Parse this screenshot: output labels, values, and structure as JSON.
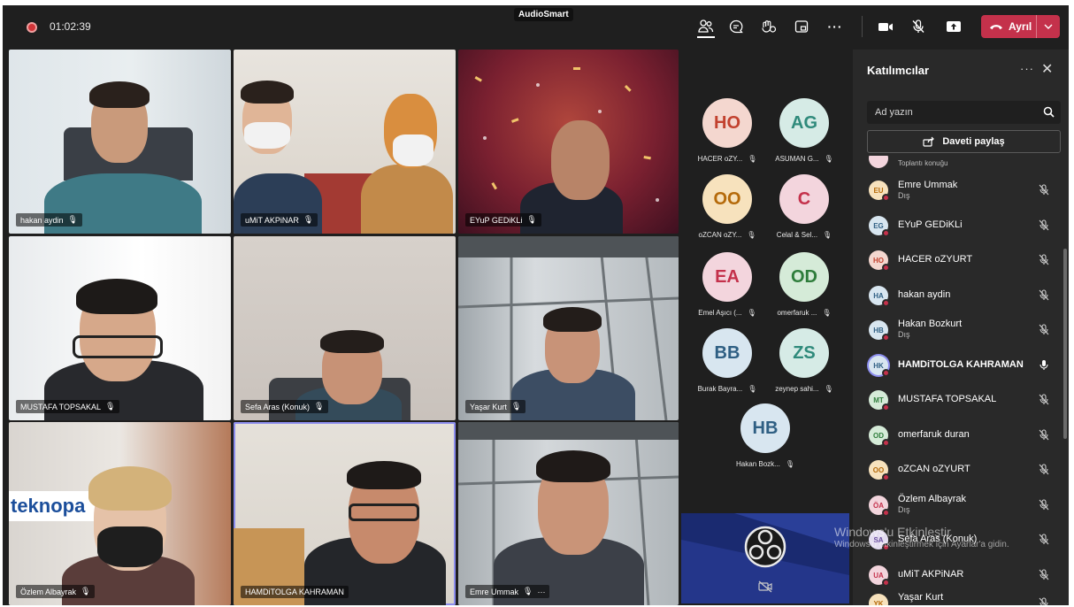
{
  "window": {
    "app_title": "AudioSmart"
  },
  "meeting": {
    "timer": "01:02:39"
  },
  "toolbar": {
    "buttons": [
      "people-icon",
      "chat-icon",
      "reactions-icon",
      "rooms-icon",
      "more-icon",
      "camera-icon",
      "mic-muted-icon",
      "share-icon"
    ],
    "leave_label": "Ayrıl"
  },
  "video_tiles": [
    {
      "name": "hakan aydin"
    },
    {
      "name": "uMiT AKPiNAR"
    },
    {
      "name": "EYuP GEDiKLi"
    },
    {
      "name": "MUSTAFA TOPSAKAL"
    },
    {
      "name": "Sefa Aras (Konuk)"
    },
    {
      "name": "Yaşar Kurt"
    },
    {
      "name": "Özlem Albayrak"
    },
    {
      "name": "HAMDiTOLGA KAHRAMAN"
    },
    {
      "name": "Emre Ummak",
      "more": "···"
    }
  ],
  "sign_text": "teknopa",
  "avatar_tiles": [
    {
      "initials": "HO",
      "label": "HACER oZY...",
      "bg": "#f4d7cf",
      "fg": "#c2412e"
    },
    {
      "initials": "AG",
      "label": "ASUMAN G...",
      "bg": "#d6ebe6",
      "fg": "#2f8a7b"
    },
    {
      "initials": "OO",
      "label": "oZCAN oZY...",
      "bg": "#f7e2bd",
      "fg": "#b56a0a"
    },
    {
      "initials": "C",
      "label": "Celal & Sel...",
      "bg": "#f3d5dd",
      "fg": "#c4314b"
    },
    {
      "initials": "EA",
      "label": "Emel Aşıcı (...",
      "bg": "#f3d5dd",
      "fg": "#c4314b"
    },
    {
      "initials": "OD",
      "label": "omerfaruk ...",
      "bg": "#d5ebd8",
      "fg": "#2e7d3b"
    },
    {
      "initials": "BB",
      "label": "Burak Bayra...",
      "bg": "#d8e6f0",
      "fg": "#2f5f83"
    },
    {
      "initials": "ZS",
      "label": "zeynep sahi...",
      "bg": "#d6ebe6",
      "fg": "#2f8a7b"
    },
    {
      "initials": "HB",
      "label": "Hakan Bozk...",
      "bg": "#d8e6f0",
      "fg": "#2f5f83"
    }
  ],
  "panel": {
    "title": "Katılımcılar",
    "more": "···",
    "close": "✕",
    "search_placeholder": "Ad yazın",
    "share_label": "Daveti paylaş",
    "partial_label": "Toplantı konuğu",
    "participants": [
      {
        "initials": "EU",
        "name": "Emre Ummak",
        "sub": "Dış",
        "bg": "#f7e2bd",
        "fg": "#b56a0a",
        "mic": "muted"
      },
      {
        "initials": "EG",
        "name": "EYuP GEDiKLi",
        "sub": "",
        "bg": "#d8e6f0",
        "fg": "#2f5f83",
        "mic": "muted"
      },
      {
        "initials": "HO",
        "name": "HACER oZYURT",
        "sub": "",
        "bg": "#f4d7cf",
        "fg": "#c2412e",
        "mic": "muted"
      },
      {
        "initials": "HA",
        "name": "hakan aydin",
        "sub": "",
        "bg": "#d8e6f0",
        "fg": "#2f5f83",
        "mic": "muted"
      },
      {
        "initials": "HB",
        "name": "Hakan Bozkurt",
        "sub": "Dış",
        "bg": "#d8e6f0",
        "fg": "#2f5f83",
        "mic": "muted"
      },
      {
        "initials": "HK",
        "name": "HAMDiTOLGA KAHRAMAN",
        "sub": "",
        "bg": "#d8e6f0",
        "fg": "#2f5f83",
        "mic": "on"
      },
      {
        "initials": "MT",
        "name": "MUSTAFA TOPSAKAL",
        "sub": "",
        "bg": "#d5ebd8",
        "fg": "#2e7d3b",
        "mic": "muted"
      },
      {
        "initials": "OD",
        "name": "omerfaruk duran",
        "sub": "",
        "bg": "#d5ebd8",
        "fg": "#2e7d3b",
        "mic": "muted"
      },
      {
        "initials": "OO",
        "name": "oZCAN oZYURT",
        "sub": "",
        "bg": "#f7e2bd",
        "fg": "#b56a0a",
        "mic": "muted"
      },
      {
        "initials": "ÖA",
        "name": "Özlem Albayrak",
        "sub": "Dış",
        "bg": "#f3d5dd",
        "fg": "#c4314b",
        "mic": "muted"
      },
      {
        "initials": "SA",
        "name": "Sefa Aras (Konuk)",
        "sub": "",
        "bg": "#e3dcf0",
        "fg": "#6b4fa0",
        "mic": "muted"
      },
      {
        "initials": "UA",
        "name": "uMiT AKPiNAR",
        "sub": "",
        "bg": "#f3d5dd",
        "fg": "#c4314b",
        "mic": "muted"
      },
      {
        "initials": "YK",
        "name": "Yaşar Kurt",
        "sub": "",
        "bg": "#f7e2bd",
        "fg": "#b56a0a",
        "mic": "muted"
      }
    ]
  },
  "watermark": {
    "line1": "Windows'u Etkinleştir",
    "line2": "Windows'u etkinleştirmek için Ayarlar'a gidin."
  },
  "colors": {
    "accent": "#c4314b",
    "panel_bg": "#292929",
    "stage_bg": "#1f1f1f",
    "active_outline": "#8b8ced"
  }
}
